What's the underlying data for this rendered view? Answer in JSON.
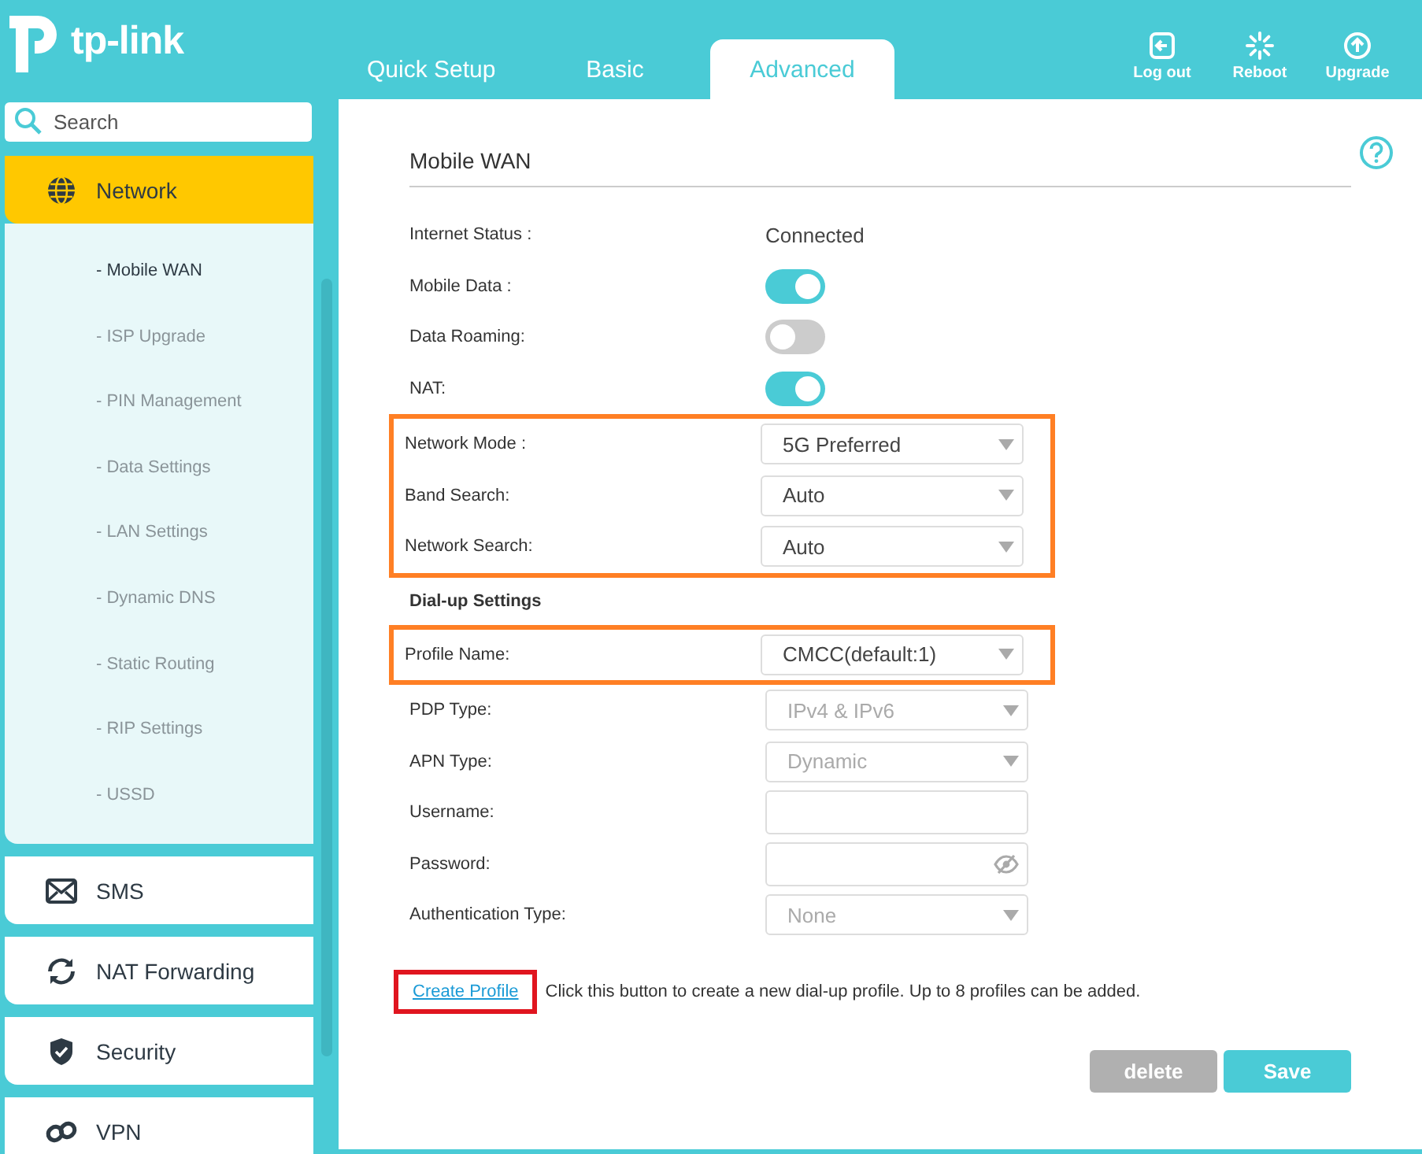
{
  "header": {
    "logo": "tp-link",
    "tabs": [
      {
        "label": "Quick Setup",
        "selected": false
      },
      {
        "label": "Basic",
        "selected": false
      },
      {
        "label": "Advanced",
        "selected": true
      }
    ],
    "actions": [
      {
        "kind": "logout",
        "label": "Log out"
      },
      {
        "kind": "reboot",
        "label": "Reboot"
      },
      {
        "kind": "upgrade",
        "label": "Upgrade"
      }
    ]
  },
  "sidebar": {
    "search": {
      "placeholder": "Search"
    },
    "items": [
      {
        "kind": "globe",
        "label": "Network",
        "selected": true,
        "expanded": true,
        "children": [
          {
            "label": "- Mobile WAN",
            "selected": true
          },
          {
            "label": "- ISP Upgrade",
            "selected": false
          },
          {
            "label": "- PIN Management",
            "selected": false
          },
          {
            "label": "- Data Settings",
            "selected": false
          },
          {
            "label": "- LAN Settings",
            "selected": false
          },
          {
            "label": "- Dynamic DNS",
            "selected": false
          },
          {
            "label": "- Static Routing",
            "selected": false
          },
          {
            "label": "- RIP Settings",
            "selected": false
          },
          {
            "label": "- USSD",
            "selected": false
          }
        ]
      },
      {
        "kind": "mail",
        "label": "SMS",
        "selected": false,
        "expanded": false
      },
      {
        "kind": "sync",
        "label": "NAT Forwarding",
        "selected": false,
        "expanded": false
      },
      {
        "kind": "shield",
        "label": "Security",
        "selected": false,
        "expanded": false
      },
      {
        "kind": "link",
        "label": "VPN",
        "selected": false,
        "expanded": false
      }
    ]
  },
  "page": {
    "title": "Mobile WAN",
    "blocks": [
      {
        "boxed": false,
        "rows": [
          {
            "kind": "text",
            "label": "Internet Status :",
            "value": "Connected"
          },
          {
            "kind": "toggle",
            "label": "Mobile Data :",
            "on": true
          },
          {
            "kind": "toggle",
            "label": "Data Roaming:",
            "on": false
          },
          {
            "kind": "toggle",
            "label": "NAT:",
            "on": true
          }
        ]
      },
      {
        "boxed": true,
        "rows": [
          {
            "kind": "select",
            "label": "Network Mode :",
            "value": "5G Preferred",
            "disabled": false
          },
          {
            "kind": "select",
            "label": "Band Search:",
            "value": "Auto",
            "disabled": false
          },
          {
            "kind": "select",
            "label": "Network Search:",
            "value": "Auto",
            "disabled": false
          }
        ]
      },
      {
        "boxed": false,
        "rows": [
          {
            "kind": "heading",
            "label": "Dial-up Settings"
          }
        ]
      },
      {
        "boxed": true,
        "rows": [
          {
            "kind": "select",
            "label": "Profile Name:",
            "value": "CMCC(default:1)",
            "disabled": false
          }
        ]
      },
      {
        "boxed": false,
        "rows": [
          {
            "kind": "select",
            "label": "PDP Type:",
            "value": "IPv4 & IPv6",
            "disabled": true
          },
          {
            "kind": "select",
            "label": "APN Type:",
            "value": "Dynamic",
            "disabled": true
          },
          {
            "kind": "input",
            "label": "Username:"
          },
          {
            "kind": "password",
            "label": "Password:"
          },
          {
            "kind": "select",
            "label": "Authentication Type:",
            "value": "None",
            "disabled": true
          }
        ]
      }
    ],
    "create": {
      "link": "Create Profile",
      "boxed": true,
      "note": "Click this button to create a new dial-up profile. Up to 8 profiles can be added."
    },
    "buttons": [
      {
        "kind": "secondary",
        "label": "delete"
      },
      {
        "kind": "primary",
        "label": "Save"
      }
    ]
  }
}
